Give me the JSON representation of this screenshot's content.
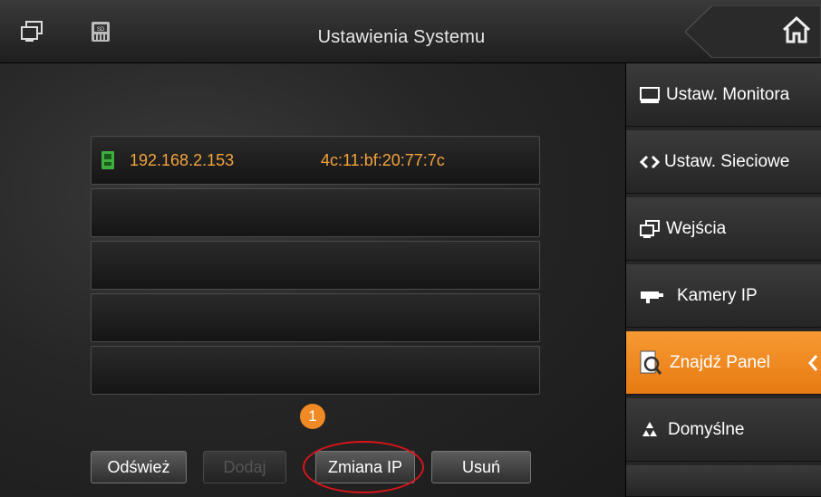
{
  "header": {
    "title": "Ustawienia Systemu",
    "sd_label": "SD"
  },
  "device_list": {
    "rows": [
      {
        "ip": "192.168.2.153",
        "mac": "4c:11:bf:20:77:7c"
      },
      {
        "ip": "",
        "mac": ""
      },
      {
        "ip": "",
        "mac": ""
      },
      {
        "ip": "",
        "mac": ""
      },
      {
        "ip": "",
        "mac": ""
      }
    ]
  },
  "annotation": {
    "badge": "1"
  },
  "buttons": {
    "refresh": "Odśwież",
    "add": "Dodaj",
    "change_ip": "Zmiana IP",
    "delete": "Usuń"
  },
  "menu": {
    "items": [
      {
        "label": "Ustaw. Monitora",
        "icon": "monitor-icon"
      },
      {
        "label": "Ustaw. Sieciowe",
        "icon": "network-icon"
      },
      {
        "label": "Wejścia",
        "icon": "inputs-icon"
      },
      {
        "label": "Kamery IP",
        "icon": "camera-icon"
      },
      {
        "label": "Znajdź Panel",
        "icon": "find-panel-icon",
        "active": true
      },
      {
        "label": "Domyślne",
        "icon": "recycle-icon"
      }
    ]
  },
  "colors": {
    "accent": "#f08a24",
    "text_value": "#f3a33b",
    "highlight": "#d9141b"
  }
}
